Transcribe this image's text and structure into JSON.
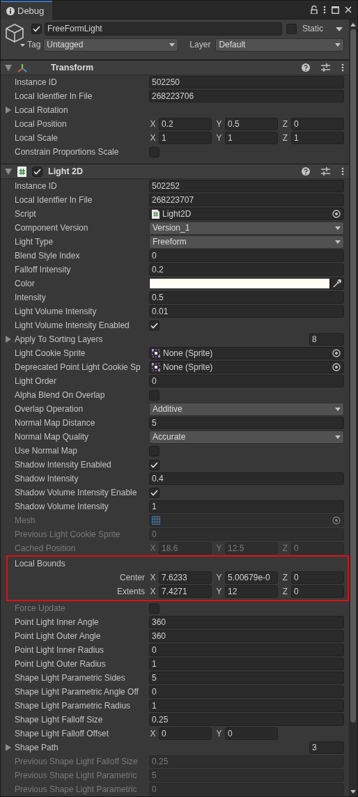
{
  "window": {
    "tab": "Debug"
  },
  "game_object": {
    "active": true,
    "name": "FreeFormLight",
    "static": false,
    "static_label": "Static",
    "tag_label": "Tag",
    "tag": "Untagged",
    "layer_label": "Layer",
    "layer": "Default"
  },
  "components": [
    {
      "kind": "transform",
      "title": "Transform",
      "expanded": true,
      "rows": [
        {
          "kind": "text",
          "label": "Instance ID",
          "value": "502250",
          "disabled": false
        },
        {
          "kind": "text",
          "label": "Local Identfier In File",
          "value": "268223706",
          "disabled": false
        },
        {
          "kind": "foldout",
          "label": "Local Rotation",
          "expanded": false,
          "disabled": false
        },
        {
          "kind": "vector",
          "label": "Local Position",
          "axes": [
            {
              "axis": "X",
              "value": "0.2"
            },
            {
              "axis": "Y",
              "value": "0.5"
            },
            {
              "axis": "Z",
              "value": "0"
            }
          ],
          "disabled": false
        },
        {
          "kind": "vector",
          "label": "Local Scale",
          "axes": [
            {
              "axis": "X",
              "value": "1"
            },
            {
              "axis": "Y",
              "value": "1"
            },
            {
              "axis": "Z",
              "value": "1"
            }
          ],
          "disabled": false
        },
        {
          "kind": "checkbox",
          "label": "Constrain Proportions Scale",
          "checked": false,
          "disabled": false
        }
      ]
    },
    {
      "kind": "script",
      "title": "Light 2D",
      "expanded": true,
      "enabled": true,
      "rows": [
        {
          "kind": "text",
          "label": "Instance ID",
          "value": "502252",
          "disabled": false
        },
        {
          "kind": "text",
          "label": "Local Identfier In File",
          "value": "268223707",
          "disabled": false
        },
        {
          "kind": "object",
          "label": "Script",
          "object": {
            "kind": "script",
            "value": "Light2D"
          },
          "disabled": false
        },
        {
          "kind": "dropdown",
          "label": "Component Version",
          "value": "Version_1",
          "disabled": false
        },
        {
          "kind": "dropdown",
          "label": "Light Type",
          "value": "Freeform",
          "disabled": false
        },
        {
          "kind": "text",
          "label": "Blend Style Index",
          "value": "0",
          "disabled": false
        },
        {
          "kind": "text",
          "label": "Falloff Intensity",
          "value": "0.2",
          "disabled": false
        },
        {
          "kind": "color",
          "label": "Color",
          "color": "#fefef2",
          "disabled": false
        },
        {
          "kind": "text",
          "label": "Intensity",
          "value": "0.5",
          "disabled": false
        },
        {
          "kind": "text",
          "label": "Light Volume Intensity",
          "value": "0.01",
          "disabled": false
        },
        {
          "kind": "checkbox",
          "label": "Light Volume Intensity Enabled",
          "checked": true,
          "disabled": false
        },
        {
          "kind": "foldout",
          "label": "Apply To Sorting Layers",
          "expanded": false,
          "count": "8",
          "disabled": false
        },
        {
          "kind": "object",
          "label": "Light Cookie Sprite",
          "object": {
            "kind": "sprite",
            "value": "None (Sprite)"
          },
          "disabled": false
        },
        {
          "kind": "object",
          "label": "Deprecated Point Light Cookie Sp",
          "object": {
            "kind": "sprite",
            "value": "None (Sprite)"
          },
          "disabled": false
        },
        {
          "kind": "text",
          "label": "Light Order",
          "value": "0",
          "disabled": false
        },
        {
          "kind": "checkbox",
          "label": "Alpha Blend On Overlap",
          "checked": false,
          "disabled": false
        },
        {
          "kind": "dropdown",
          "label": "Overlap Operation",
          "value": "Additive",
          "disabled": false
        },
        {
          "kind": "text",
          "label": "Normal Map Distance",
          "value": "5",
          "disabled": false
        },
        {
          "kind": "dropdown",
          "label": "Normal Map Quality",
          "value": "Accurate",
          "disabled": false
        },
        {
          "kind": "checkbox",
          "label": "Use Normal Map",
          "checked": false,
          "disabled": false
        },
        {
          "kind": "checkbox",
          "label": "Shadow Intensity Enabled",
          "checked": true,
          "disabled": false
        },
        {
          "kind": "text",
          "label": "Shadow Intensity",
          "value": "0.4",
          "disabled": false
        },
        {
          "kind": "checkbox",
          "label": "Shadow Volume Intensity Enable",
          "checked": true,
          "disabled": false
        },
        {
          "kind": "text",
          "label": "Shadow Volume Intensity",
          "value": "1",
          "disabled": false
        },
        {
          "kind": "object",
          "label": "Mesh",
          "object": {
            "kind": "mesh"
          },
          "disabled": true
        },
        {
          "kind": "text",
          "label": "Previous Light Cookie Sprite",
          "value": "0",
          "disabled": true
        },
        {
          "kind": "vector",
          "label": "Cached Position",
          "axes": [
            {
              "axis": "X",
              "value": "18.6"
            },
            {
              "axis": "Y",
              "value": "12.5"
            },
            {
              "axis": "Z",
              "value": "0"
            }
          ],
          "disabled": true
        },
        {
          "kind": "bounds",
          "label": "Local Bounds",
          "highlighted": true,
          "disabled": false,
          "rows": [
            {
              "label": "Center",
              "axes": [
                {
                  "axis": "X",
                  "value": "7.6233"
                },
                {
                  "axis": "Y",
                  "value": "5.00679e-0"
                },
                {
                  "axis": "Z",
                  "value": "0"
                }
              ]
            },
            {
              "label": "Extents",
              "axes": [
                {
                  "axis": "X",
                  "value": "7.4271"
                },
                {
                  "axis": "Y",
                  "value": "12"
                },
                {
                  "axis": "Z",
                  "value": "0"
                }
              ]
            }
          ]
        },
        {
          "kind": "checkbox",
          "label": "Force Update",
          "checked": false,
          "disabled": true
        },
        {
          "kind": "text",
          "label": "Point Light Inner Angle",
          "value": "360",
          "disabled": false
        },
        {
          "kind": "text",
          "label": "Point Light Outer Angle",
          "value": "360",
          "disabled": false
        },
        {
          "kind": "text",
          "label": "Point Light Inner Radius",
          "value": "0",
          "disabled": false
        },
        {
          "kind": "text",
          "label": "Point Light Outer Radius",
          "value": "1",
          "disabled": false
        },
        {
          "kind": "text",
          "label": "Shape Light Parametric Sides",
          "value": "5",
          "disabled": false
        },
        {
          "kind": "text",
          "label": "Shape Light Parametric Angle Off",
          "value": "0",
          "disabled": false
        },
        {
          "kind": "text",
          "label": "Shape Light Parametric Radius",
          "value": "1",
          "disabled": false
        },
        {
          "kind": "text",
          "label": "Shape Light Falloff Size",
          "value": "0.25",
          "disabled": false
        },
        {
          "kind": "vector",
          "label": "Shape Light Falloff Offset",
          "axes": [
            {
              "axis": "X",
              "value": "0"
            },
            {
              "axis": "Y",
              "value": "0"
            }
          ],
          "disabled": false
        },
        {
          "kind": "foldout",
          "label": "Shape Path",
          "expanded": false,
          "count": "3",
          "disabled": false
        },
        {
          "kind": "text",
          "label": "Previous Shape Light Falloff Size",
          "value": "0.25",
          "disabled": true
        },
        {
          "kind": "text",
          "label": "Previous Shape Light Parametric",
          "value": "5",
          "disabled": true
        },
        {
          "kind": "text",
          "label": "Previous Shape Light Parametric",
          "value": "0",
          "disabled": true
        }
      ]
    }
  ]
}
